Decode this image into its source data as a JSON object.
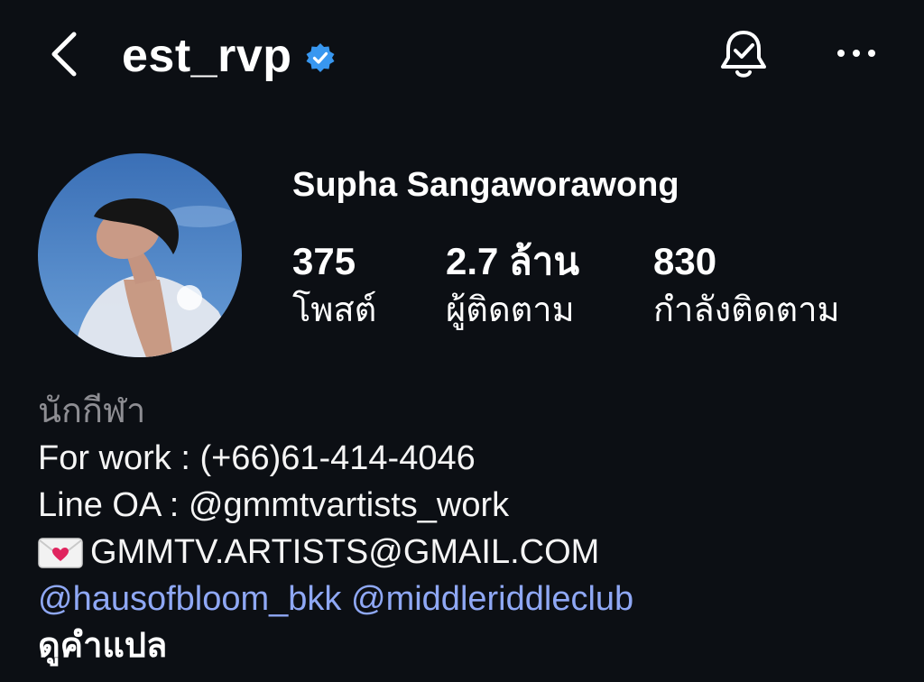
{
  "header": {
    "username": "est_rvp",
    "back_icon": "chevron-left-icon",
    "verified_icon": "verified-badge-icon",
    "verified_color": "#3897f0",
    "notification_icon": "bell-check-icon",
    "more_icon": "more-horizontal-icon"
  },
  "profile": {
    "full_name": "Supha Sangaworawong",
    "stats": [
      {
        "value": "375",
        "label": "โพสต์"
      },
      {
        "value": "2.7 ล้าน",
        "label": "ผู้ติดตาม"
      },
      {
        "value": "830",
        "label": "กำลังติดตาม"
      }
    ]
  },
  "bio": {
    "category": "นักกีฬา",
    "line1": "For work : (+66)61-414-4046",
    "line2": "Line OA : @gmmtvartists_work",
    "email": "GMMTV.ARTISTS@GMAIL.COM",
    "email_icon": "love-letter-icon",
    "mentions": [
      "@hausofbloom_bkk",
      "@middleriddleclub"
    ],
    "mention_color": "#8fa8f5",
    "see_translation": "ดูคำแปล"
  }
}
